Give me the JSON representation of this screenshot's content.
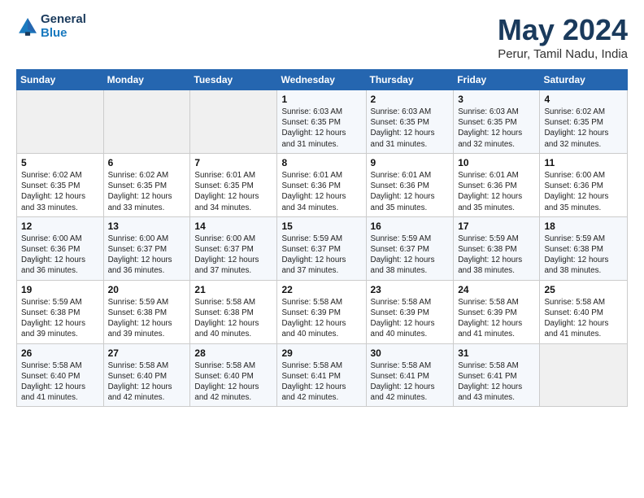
{
  "header": {
    "logo_line1": "General",
    "logo_line2": "Blue",
    "month": "May 2024",
    "location": "Perur, Tamil Nadu, India"
  },
  "weekdays": [
    "Sunday",
    "Monday",
    "Tuesday",
    "Wednesday",
    "Thursday",
    "Friday",
    "Saturday"
  ],
  "weeks": [
    [
      {
        "day": "",
        "info": ""
      },
      {
        "day": "",
        "info": ""
      },
      {
        "day": "",
        "info": ""
      },
      {
        "day": "1",
        "info": "Sunrise: 6:03 AM\nSunset: 6:35 PM\nDaylight: 12 hours\nand 31 minutes."
      },
      {
        "day": "2",
        "info": "Sunrise: 6:03 AM\nSunset: 6:35 PM\nDaylight: 12 hours\nand 31 minutes."
      },
      {
        "day": "3",
        "info": "Sunrise: 6:03 AM\nSunset: 6:35 PM\nDaylight: 12 hours\nand 32 minutes."
      },
      {
        "day": "4",
        "info": "Sunrise: 6:02 AM\nSunset: 6:35 PM\nDaylight: 12 hours\nand 32 minutes."
      }
    ],
    [
      {
        "day": "5",
        "info": "Sunrise: 6:02 AM\nSunset: 6:35 PM\nDaylight: 12 hours\nand 33 minutes."
      },
      {
        "day": "6",
        "info": "Sunrise: 6:02 AM\nSunset: 6:35 PM\nDaylight: 12 hours\nand 33 minutes."
      },
      {
        "day": "7",
        "info": "Sunrise: 6:01 AM\nSunset: 6:35 PM\nDaylight: 12 hours\nand 34 minutes."
      },
      {
        "day": "8",
        "info": "Sunrise: 6:01 AM\nSunset: 6:36 PM\nDaylight: 12 hours\nand 34 minutes."
      },
      {
        "day": "9",
        "info": "Sunrise: 6:01 AM\nSunset: 6:36 PM\nDaylight: 12 hours\nand 35 minutes."
      },
      {
        "day": "10",
        "info": "Sunrise: 6:01 AM\nSunset: 6:36 PM\nDaylight: 12 hours\nand 35 minutes."
      },
      {
        "day": "11",
        "info": "Sunrise: 6:00 AM\nSunset: 6:36 PM\nDaylight: 12 hours\nand 35 minutes."
      }
    ],
    [
      {
        "day": "12",
        "info": "Sunrise: 6:00 AM\nSunset: 6:36 PM\nDaylight: 12 hours\nand 36 minutes."
      },
      {
        "day": "13",
        "info": "Sunrise: 6:00 AM\nSunset: 6:37 PM\nDaylight: 12 hours\nand 36 minutes."
      },
      {
        "day": "14",
        "info": "Sunrise: 6:00 AM\nSunset: 6:37 PM\nDaylight: 12 hours\nand 37 minutes."
      },
      {
        "day": "15",
        "info": "Sunrise: 5:59 AM\nSunset: 6:37 PM\nDaylight: 12 hours\nand 37 minutes."
      },
      {
        "day": "16",
        "info": "Sunrise: 5:59 AM\nSunset: 6:37 PM\nDaylight: 12 hours\nand 38 minutes."
      },
      {
        "day": "17",
        "info": "Sunrise: 5:59 AM\nSunset: 6:38 PM\nDaylight: 12 hours\nand 38 minutes."
      },
      {
        "day": "18",
        "info": "Sunrise: 5:59 AM\nSunset: 6:38 PM\nDaylight: 12 hours\nand 38 minutes."
      }
    ],
    [
      {
        "day": "19",
        "info": "Sunrise: 5:59 AM\nSunset: 6:38 PM\nDaylight: 12 hours\nand 39 minutes."
      },
      {
        "day": "20",
        "info": "Sunrise: 5:59 AM\nSunset: 6:38 PM\nDaylight: 12 hours\nand 39 minutes."
      },
      {
        "day": "21",
        "info": "Sunrise: 5:58 AM\nSunset: 6:38 PM\nDaylight: 12 hours\nand 40 minutes."
      },
      {
        "day": "22",
        "info": "Sunrise: 5:58 AM\nSunset: 6:39 PM\nDaylight: 12 hours\nand 40 minutes."
      },
      {
        "day": "23",
        "info": "Sunrise: 5:58 AM\nSunset: 6:39 PM\nDaylight: 12 hours\nand 40 minutes."
      },
      {
        "day": "24",
        "info": "Sunrise: 5:58 AM\nSunset: 6:39 PM\nDaylight: 12 hours\nand 41 minutes."
      },
      {
        "day": "25",
        "info": "Sunrise: 5:58 AM\nSunset: 6:40 PM\nDaylight: 12 hours\nand 41 minutes."
      }
    ],
    [
      {
        "day": "26",
        "info": "Sunrise: 5:58 AM\nSunset: 6:40 PM\nDaylight: 12 hours\nand 41 minutes."
      },
      {
        "day": "27",
        "info": "Sunrise: 5:58 AM\nSunset: 6:40 PM\nDaylight: 12 hours\nand 42 minutes."
      },
      {
        "day": "28",
        "info": "Sunrise: 5:58 AM\nSunset: 6:40 PM\nDaylight: 12 hours\nand 42 minutes."
      },
      {
        "day": "29",
        "info": "Sunrise: 5:58 AM\nSunset: 6:41 PM\nDaylight: 12 hours\nand 42 minutes."
      },
      {
        "day": "30",
        "info": "Sunrise: 5:58 AM\nSunset: 6:41 PM\nDaylight: 12 hours\nand 42 minutes."
      },
      {
        "day": "31",
        "info": "Sunrise: 5:58 AM\nSunset: 6:41 PM\nDaylight: 12 hours\nand 43 minutes."
      },
      {
        "day": "",
        "info": ""
      }
    ]
  ]
}
